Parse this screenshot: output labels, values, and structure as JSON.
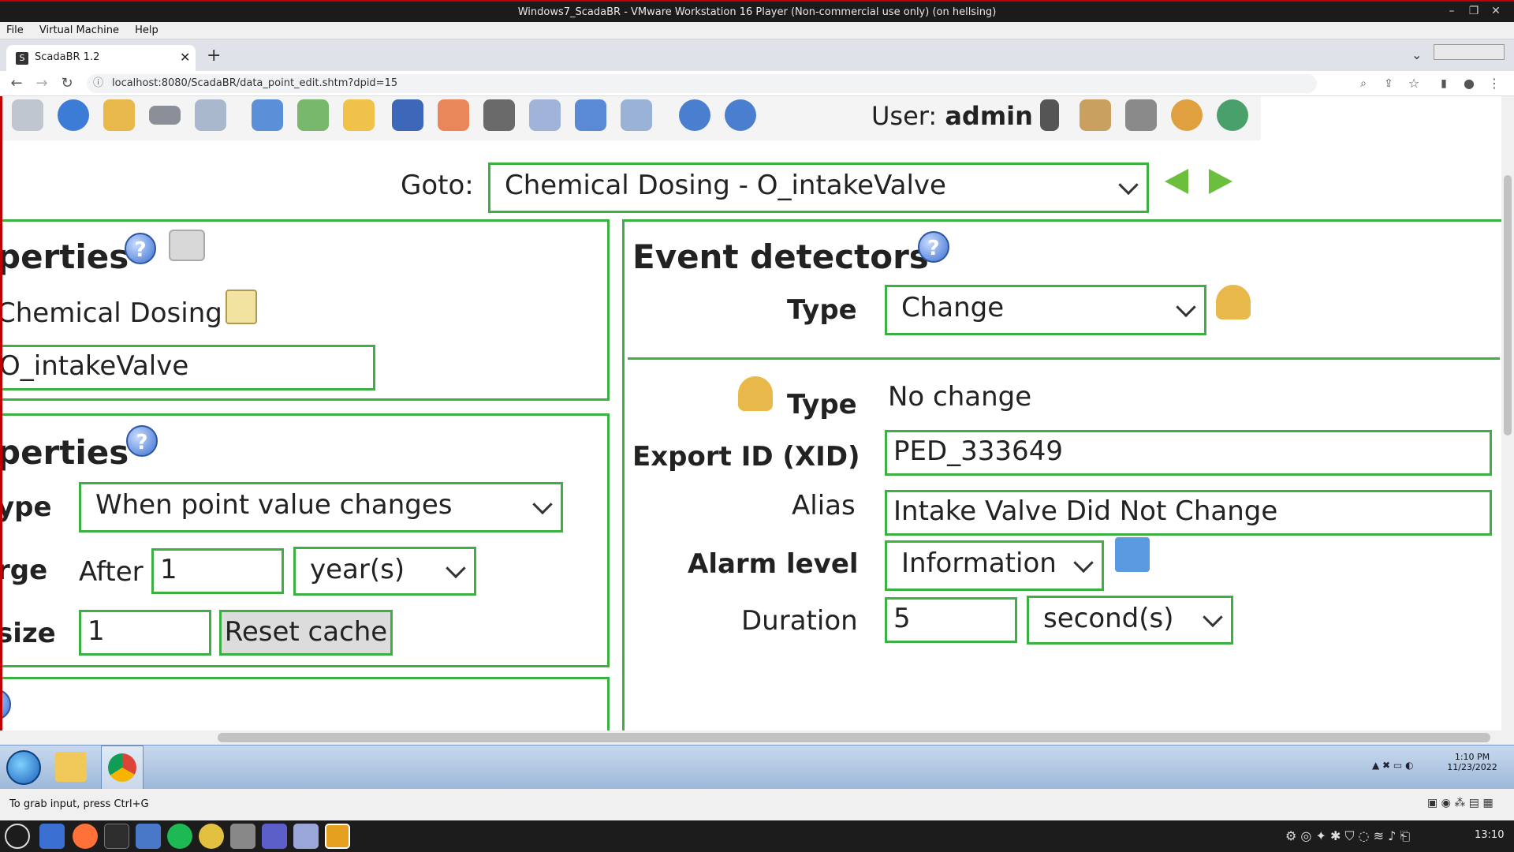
{
  "vm": {
    "title": "Windows7_ScadaBR - VMware Workstation 16 Player (Non-commercial use only) (on hellsing)",
    "menu": [
      "File",
      "Virtual Machine",
      "Help"
    ],
    "status_text": "To grab input, press Ctrl+G"
  },
  "browser": {
    "tab_title": "ScadaBR 1.2",
    "tab_favicon": "S",
    "url": "localhost:8080/ScadaBR/data_point_edit.shtm?dpid=15"
  },
  "header": {
    "user_label": "User:",
    "user_name": "admin"
  },
  "goto": {
    "label": "Goto:",
    "selected": "Chemical Dosing - O_intakeValve"
  },
  "left": {
    "panel1_title": "perties",
    "datasource_name": "Chemical Dosing",
    "point_name": "O_intakeValve",
    "panel2_title": "perties",
    "logging_type_label": "ype",
    "logging_type_value": "When point value changes",
    "purge_label": "rge",
    "purge_after": "After",
    "purge_value": "1",
    "purge_unit": "year(s)",
    "cache_label": "size",
    "cache_value": "1",
    "reset_cache": "Reset cache"
  },
  "event_detectors": {
    "title": "Event detectors",
    "type_label": "Type",
    "type_value": "Change",
    "detector": {
      "type_label": "Type",
      "type_value": "No change",
      "xid_label": "Export ID (XID)",
      "xid_value": "PED_333649",
      "alias_label": "Alias",
      "alias_value": "Intake Valve Did Not Change",
      "alarm_label": "Alarm level",
      "alarm_value": "Information",
      "duration_label": "Duration",
      "duration_value": "5",
      "duration_unit": "second(s)"
    }
  },
  "win7": {
    "time": "1:10 PM",
    "date": "11/23/2022"
  },
  "host": {
    "time": "13:10"
  },
  "colors": {
    "panel_border": "#3cb043",
    "vm_frame": "#c00000"
  }
}
